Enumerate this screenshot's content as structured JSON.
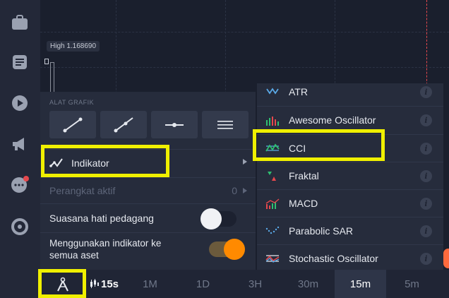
{
  "chart": {
    "high_label": "High  1.168690"
  },
  "panel": {
    "section_title": "ALAT GRAFIK",
    "tools": [
      {
        "icon": "trend-line-icon"
      },
      {
        "icon": "ray-line-icon"
      },
      {
        "icon": "horizontal-line-icon"
      },
      {
        "icon": "fibonacci-lines-icon"
      }
    ],
    "indicator_label": "Indikator",
    "active_label": "Perangkat aktif",
    "active_count": "0",
    "sentiment_label": "Suasana hati pedagang",
    "sentiment_on": false,
    "all_assets_label_1": "Menggunakan indikator ke",
    "all_assets_label_2": "semua aset",
    "all_assets_on": true
  },
  "indicators": {
    "items": [
      {
        "label": "ATR"
      },
      {
        "label": "Awesome Oscillator"
      },
      {
        "label": "CCI"
      },
      {
        "label": "Fraktal"
      },
      {
        "label": "MACD"
      },
      {
        "label": "Parabolic SAR"
      },
      {
        "label": "Stochastic Oscillator"
      }
    ],
    "info_glyph": "i"
  },
  "timeframes": {
    "current": "15s",
    "options": [
      "1M",
      "1D",
      "3H",
      "30m",
      "15m",
      "5m"
    ],
    "selected": "15m"
  },
  "colors": {
    "highlight": "#f0f000",
    "toggle_on": "#ff8a00",
    "accent_green": "#2fbf71",
    "accent_red": "#e5484d"
  }
}
